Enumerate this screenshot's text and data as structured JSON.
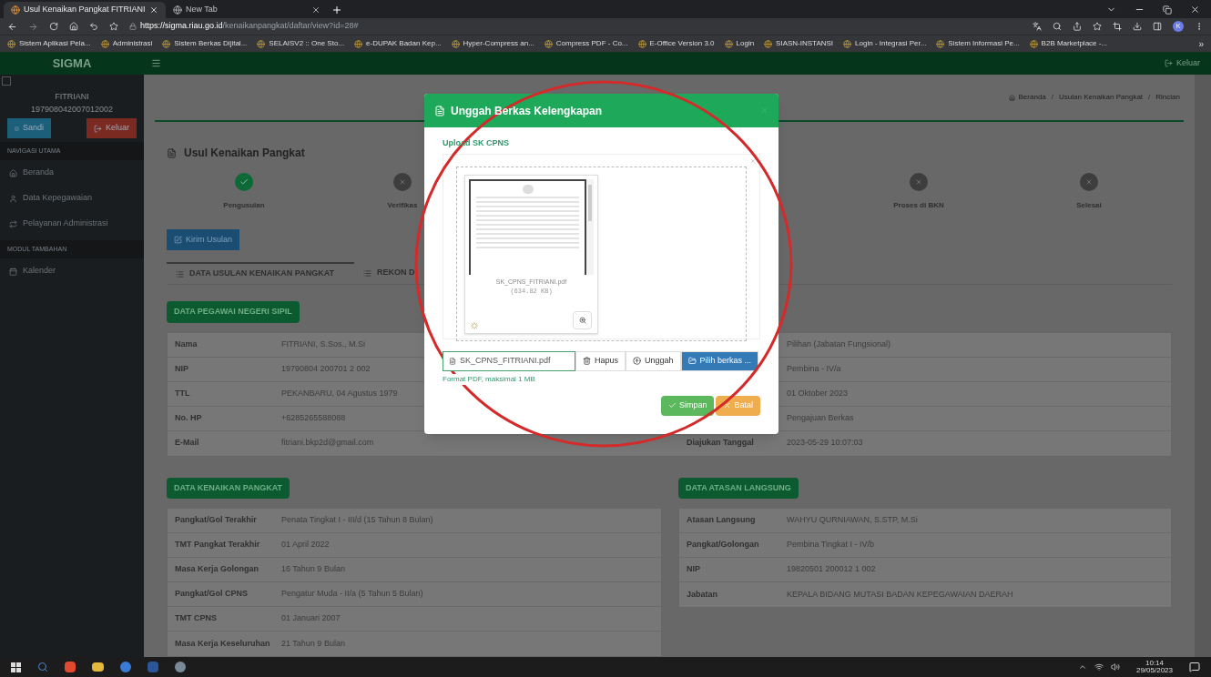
{
  "browser": {
    "tabs": [
      {
        "title": "Usul Kenaikan Pangkat FITRIANI",
        "selected": true
      },
      {
        "title": "New Tab",
        "selected": false
      }
    ],
    "url_host": "https://sigma.riau.go.id",
    "url_path": "/kenaikanpangkat/daftar/view?id=28#",
    "bookmarks": [
      "Sistem Aplikasi Pela...",
      "Administrasi",
      "Sistem Berkas Dijital...",
      "SELAISV2 :: One Sto...",
      "e-DUPAK Badan Kep...",
      "Hyper-Compress an...",
      "Compress PDF - Co...",
      "E-Office Version 3.0",
      "Login",
      "SIASN-INSTANSI",
      "Login - Integrasi Per...",
      "Sistem Informasi Pe...",
      "B2B Marketplace -..."
    ],
    "overflow": "»",
    "profile": "K"
  },
  "app": {
    "brand": "SIGMA",
    "logout": "Keluar"
  },
  "sidebar": {
    "toggle_checked": false,
    "user_name": "FITRIANI",
    "user_id": "197908042007012002",
    "buttons": [
      {
        "label": "Sandi",
        "kind": "password"
      },
      {
        "label": "Keluar",
        "kind": "logout"
      }
    ],
    "sections": [
      {
        "heading": "NAVIGASI UTAMA",
        "items": [
          {
            "label": "Beranda",
            "kind": "home"
          },
          {
            "label": "Data Kepegawaian",
            "kind": "user"
          },
          {
            "label": "Pelayanan Administrasi",
            "kind": "service"
          }
        ]
      },
      {
        "heading": "MODUL TAMBAHAN",
        "items": [
          {
            "label": "Kalender",
            "kind": "calendar"
          }
        ]
      }
    ]
  },
  "breadcrumb": [
    "Beranda",
    "Usulan Kenaikan Pangkat",
    "Rincian"
  ],
  "breadcrumb_separator": "/",
  "page_title": "Usul Kenaikan Pangkat",
  "steps": [
    {
      "label": "Pengusulan",
      "done": true
    },
    {
      "label": "Verifikas",
      "done": false
    },
    {
      "label": "Proses di BKN",
      "done": false
    },
    {
      "label": "Selesai",
      "done": false
    }
  ],
  "send_button": "Kirim Usulan",
  "tabs": [
    {
      "label": "DATA USULAN KENAIKAN PANGKAT",
      "selected": true
    },
    {
      "label": "REKON D",
      "selected": false
    }
  ],
  "pns": {
    "heading": "DATA PEGAWAI NEGERI SIPIL",
    "rows": [
      {
        "label": "Nama",
        "value": "FITRIANI, S.Sos., M.Si",
        "value_2": "Pilihan (Jabatan Fungsional)"
      },
      {
        "label": "NIP",
        "value": "19790804 200701 2 002",
        "value_2": "Pembina - IV/a"
      },
      {
        "label": "TTL",
        "value": "PEKANBARU, 04 Agustus 1979",
        "value_2": "01 Oktober 2023"
      },
      {
        "label": "No. HP",
        "value": "+6285265588088",
        "value_2": "Pengajuan Berkas"
      },
      {
        "label": "E-Mail",
        "value": "fitriani.bkp2d@gmail.com",
        "label_2": "Diajukan Tanggal",
        "value_2": "2023-05-29 10:07:03"
      }
    ]
  },
  "kenaikan": {
    "heading": "DATA KENAIKAN PANGKAT",
    "rows": [
      {
        "label": "Pangkat/Gol Terakhir",
        "value": "Penata Tingkat I - III/d (15 Tahun 8 Bulan)"
      },
      {
        "label": "TMT Pangkat Terakhir",
        "value": "01 April 2022"
      },
      {
        "label": "Masa Kerja Golongan",
        "value": "16 Tahun 9 Bulan"
      },
      {
        "label": "Pangkat/Gol CPNS",
        "value": "Pengatur Muda - II/a (5 Tahun 5 Bulan)"
      },
      {
        "label": "TMT CPNS",
        "value": "01 Januari 2007"
      },
      {
        "label": "Masa Kerja Keseluruhan",
        "value": "21 Tahun 9 Bulan"
      }
    ]
  },
  "atasan": {
    "heading": "DATA ATASAN LANGSUNG",
    "rows": [
      {
        "label": "Atasan Langsung",
        "value": "WAHYU QURNIAWAN, S.STP, M.Si"
      },
      {
        "label": "Pangkat/Golongan",
        "value": "Pembina Tingkat I - IV/b"
      },
      {
        "label": "NIP",
        "value": "19820501 200012 1 002"
      },
      {
        "label": "Jabatan",
        "value": "KEPALA BIDANG MUTASI BADAN KEPEGAWAIAN DAERAH"
      }
    ]
  },
  "modal": {
    "title": "Unggah Berkas Kelengkapan",
    "field_label": "Upload SK CPNS",
    "file": {
      "name": "SK_CPNS_FITRIANI.pdf",
      "size": "(634.82 KB)"
    },
    "file_field": "SK_CPNS_FITRIANI.pdf",
    "tools": [
      {
        "label": "Hapus",
        "kind": "delete"
      },
      {
        "label": "Unggah",
        "kind": "upload"
      },
      {
        "label": "Pilih berkas ...",
        "kind": "browse"
      }
    ],
    "hint": "Format PDF, maksimal 1 MB",
    "actions": [
      {
        "label": "Simpan",
        "kind": "save"
      },
      {
        "label": "Batal",
        "kind": "cancel"
      }
    ]
  },
  "taskbar": {
    "time": "10:14",
    "date": "29/05/2023"
  }
}
